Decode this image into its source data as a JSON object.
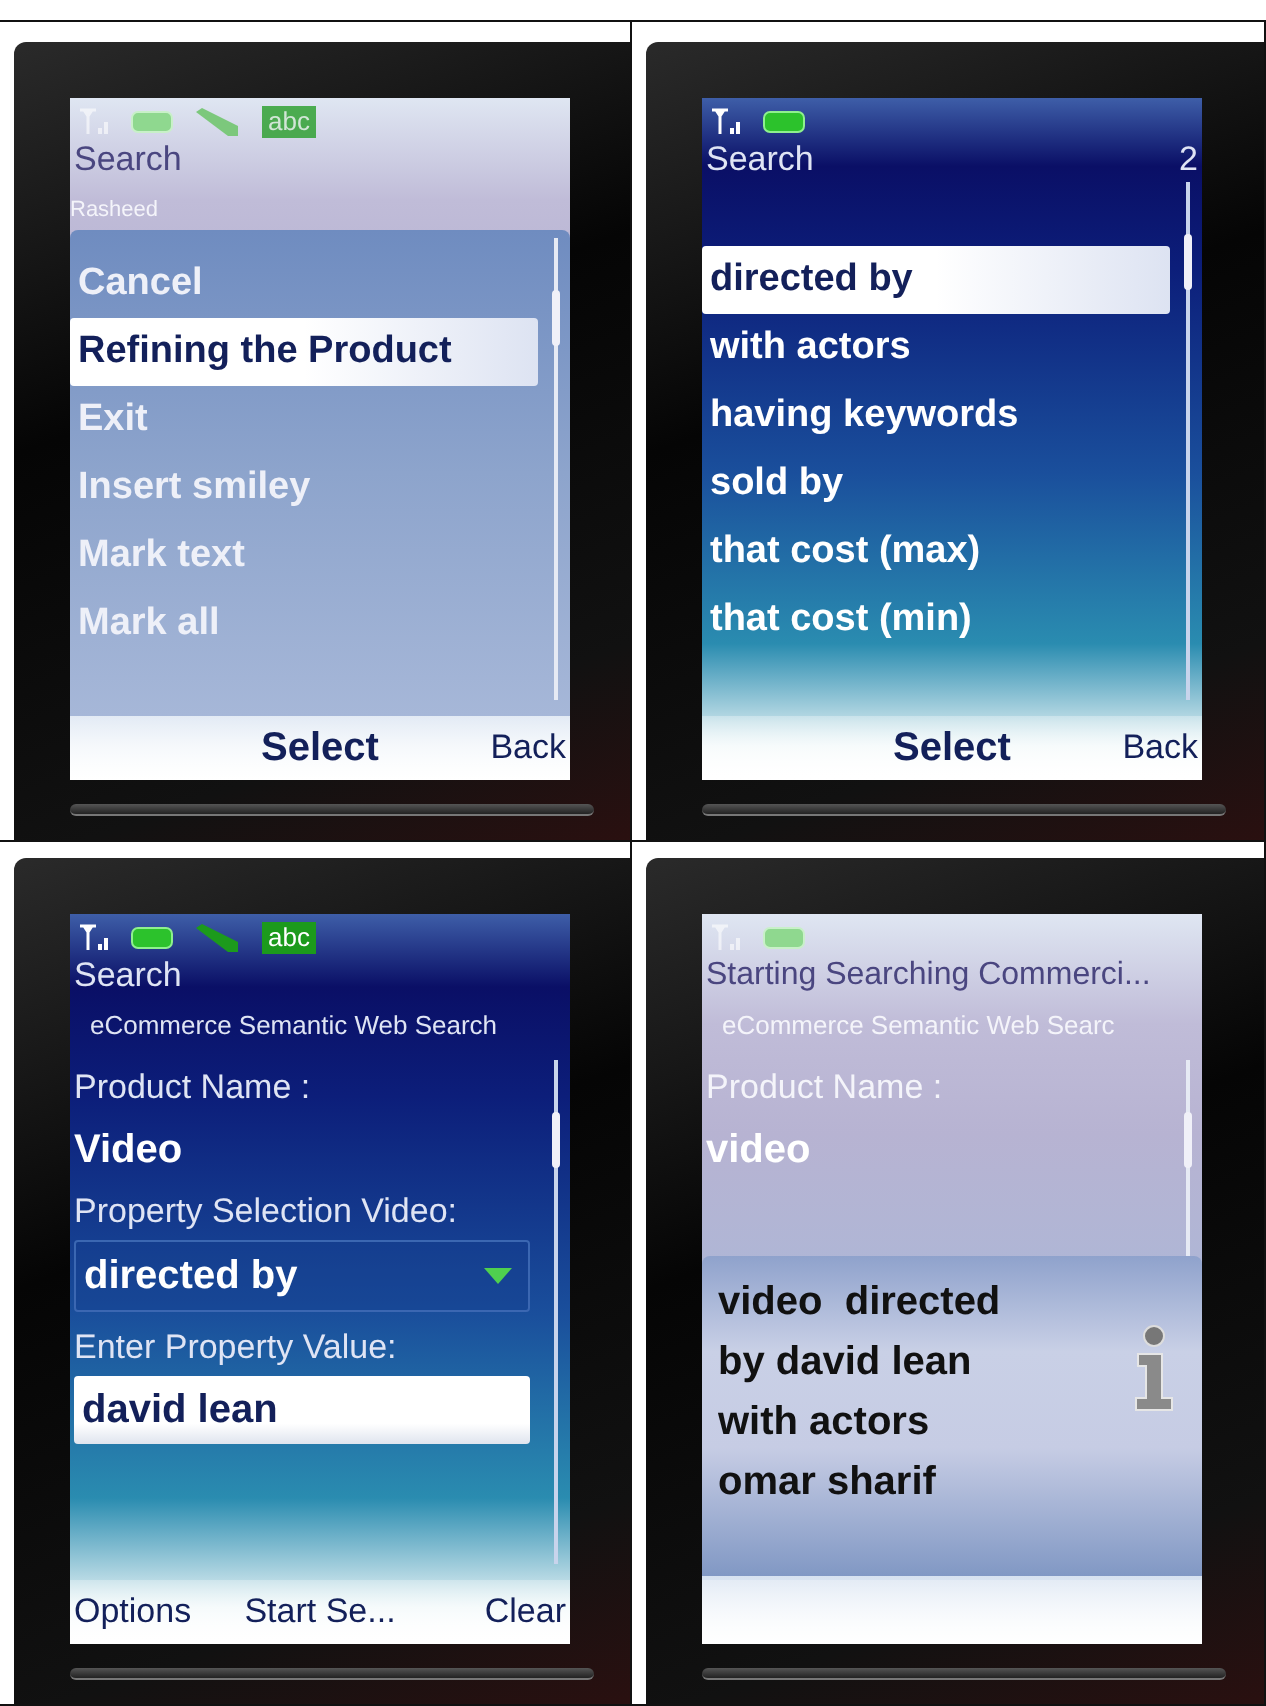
{
  "screens": [
    {
      "kind": "menu",
      "dimmed": true,
      "input_mode": "abc",
      "title": "Search",
      "subtitle": "Rasheed",
      "items": [
        {
          "label": "Cancel",
          "selected": false
        },
        {
          "label": "Refining the Product",
          "selected": true
        },
        {
          "label": "Exit",
          "selected": false
        },
        {
          "label": "Insert smiley",
          "selected": false
        },
        {
          "label": "Mark text",
          "selected": false
        },
        {
          "label": "Mark all",
          "selected": false
        }
      ],
      "softkeys": {
        "middle": "Select",
        "right": "Back"
      }
    },
    {
      "kind": "list",
      "dimmed": false,
      "title": "Search",
      "counter": "2",
      "items": [
        {
          "label": "directed by",
          "selected": true
        },
        {
          "label": "with actors",
          "selected": false
        },
        {
          "label": "having keywords",
          "selected": false
        },
        {
          "label": "sold by",
          "selected": false
        },
        {
          "label": "that cost (max)",
          "selected": false
        },
        {
          "label": "that cost (min)",
          "selected": false
        }
      ],
      "softkeys": {
        "middle": "Select",
        "right": "Back"
      }
    },
    {
      "kind": "form",
      "dimmed": false,
      "input_mode": "abc",
      "title": "Search",
      "subtitle": "eCommerce Semantic Web Search",
      "fields": [
        {
          "kind": "label",
          "text": "Product Name :"
        },
        {
          "kind": "value",
          "text": "Video"
        },
        {
          "kind": "label",
          "text": "Property Selection Video:"
        },
        {
          "kind": "dropdown",
          "text": "directed by"
        },
        {
          "kind": "label",
          "text": "Enter Property Value:"
        },
        {
          "kind": "input",
          "text": "david lean"
        }
      ],
      "softkeys": {
        "left": "Options",
        "middle": "Start Se...",
        "right": "Clear"
      }
    },
    {
      "kind": "dialog",
      "dimmed": true,
      "title": "Starting Searching Commerci...",
      "subtitle": "eCommerce Semantic Web Searc",
      "fields": [
        {
          "kind": "label",
          "text": "Product Name :"
        },
        {
          "kind": "value",
          "text": "video"
        }
      ],
      "note": "video  directed\nby david lean\nwith actors\nomar sharif"
    }
  ]
}
